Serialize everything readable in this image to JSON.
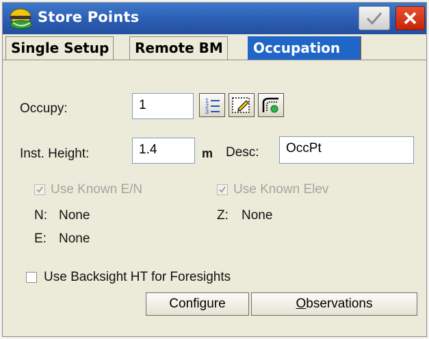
{
  "window": {
    "title": "Store Points"
  },
  "tabs": [
    {
      "label": "Single Setup",
      "active": false
    },
    {
      "label": "Remote BM",
      "active": false
    },
    {
      "label": "Occupation",
      "active": true
    }
  ],
  "form": {
    "occupy_label": "Occupy:",
    "occupy_value": "1",
    "inst_height_label": "Inst. Height:",
    "inst_height_value": "1.4",
    "inst_height_unit": "m",
    "desc_label": "Desc:",
    "desc_value": "OccPt",
    "use_known_en": {
      "label": "Use Known E/N",
      "checked": true,
      "enabled": false
    },
    "use_known_elev": {
      "label": "Use Known Elev",
      "checked": true,
      "enabled": false
    },
    "n_label": "N:",
    "n_value": "None",
    "e_label": "E:",
    "e_value": "None",
    "z_label": "Z:",
    "z_value": "None",
    "backsight": {
      "label": "Use Backsight HT for Foresights",
      "checked": false
    }
  },
  "buttons": {
    "configure": {
      "pre": "Confi",
      "key": "g",
      "post": "ure"
    },
    "observations": {
      "pre": "",
      "key": "O",
      "post": "bservations"
    }
  },
  "icons": [
    "app-helmet-icon",
    "ok-check-icon",
    "close-x-icon",
    "point-list-icon",
    "map-edit-icon",
    "from-map-icon"
  ],
  "colors": {
    "titlebar": "#2b5db3",
    "active_tab": "#1f66c8",
    "close": "#c72408",
    "background": "#ecead8"
  }
}
